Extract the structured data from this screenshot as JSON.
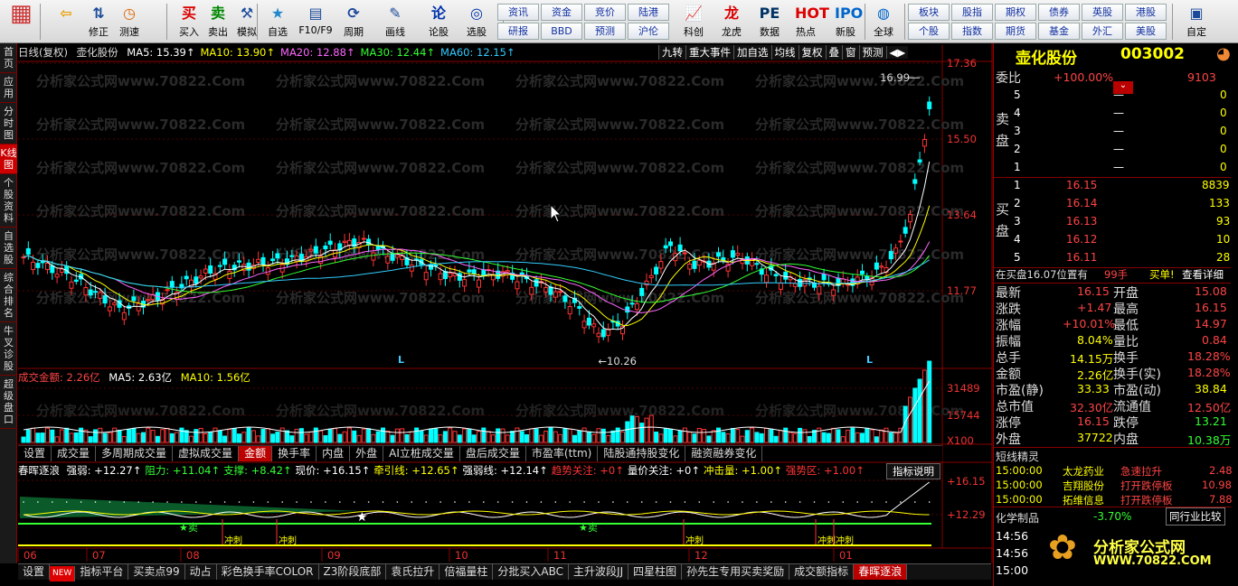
{
  "toolbar": {
    "buttons": [
      {
        "label": "",
        "icon": "app-logo-icon"
      },
      {
        "label": "",
        "icon": "back-arrow-icon"
      },
      {
        "label": "修正",
        "icon": "up-down-arrows-icon"
      },
      {
        "label": "测速",
        "icon": "clock-icon"
      },
      {
        "label": "买入",
        "icon": "buy-icon",
        "glyph": "买"
      },
      {
        "label": "卖出",
        "icon": "sell-icon",
        "glyph": "卖"
      },
      {
        "label": "模拟",
        "icon": "hammer-icon"
      },
      {
        "label": "自选",
        "icon": "star-icon"
      },
      {
        "label": "F10/F9",
        "icon": "f10-icon"
      },
      {
        "label": "周期",
        "icon": "period-icon"
      },
      {
        "label": "画线",
        "icon": "pencil-icon"
      },
      {
        "label": "论股",
        "icon": "forum-icon"
      },
      {
        "label": "选股",
        "icon": "stock-pick-icon"
      },
      {
        "label": "科创",
        "icon": "kechuang-icon"
      },
      {
        "label": "龙虎",
        "icon": "dragon-tiger-icon"
      },
      {
        "label": "数据",
        "icon": "pe-data-icon"
      },
      {
        "label": "热点",
        "icon": "hot-icon"
      },
      {
        "label": "新股",
        "icon": "ipo-icon"
      },
      {
        "label": "全球",
        "icon": "globe-icon"
      },
      {
        "label": "自定",
        "icon": "custom-icon"
      }
    ],
    "grid1": [
      "资讯",
      "资金",
      "竞价",
      "陆港",
      "研报",
      "BBD",
      "预测",
      "沪伦"
    ],
    "grid2": [
      "板块",
      "股指",
      "期权",
      "债券",
      "英股",
      "港股",
      "个股",
      "指数",
      "期货",
      "基金",
      "外汇",
      "美股"
    ]
  },
  "leftbar": [
    "首页",
    "应用",
    "分时图",
    "K线图",
    "个股资料",
    "自选股",
    "综合排名",
    "牛叉诊股",
    "超级盘口"
  ],
  "kline": {
    "title": "日线(复权)",
    "stock": "壶化股份",
    "ma": [
      {
        "label": "MA5: 15.39",
        "color": "#ffffff"
      },
      {
        "label": "MA10: 13.90",
        "color": "#ffff00"
      },
      {
        "label": "MA20: 12.88",
        "color": "#ff66ff"
      },
      {
        "label": "MA30: 12.44",
        "color": "#33ff33"
      },
      {
        "label": "MA60: 12.15",
        "color": "#33ccff"
      }
    ],
    "tools": [
      "九转",
      "重大事件",
      "加自选",
      "均线",
      "复权",
      "叠",
      "窗",
      "预测"
    ],
    "yaxis": [
      "17.36",
      "15.50",
      "13.64",
      "11.77"
    ],
    "high_label": "16.99",
    "low_label": "10.26",
    "months": [
      "06",
      "07",
      "08",
      "09",
      "10",
      "11",
      "12",
      "01"
    ],
    "watermark": "分析家公式网www.70822.Com"
  },
  "volume": {
    "title": "成交金额: 2.26亿",
    "ma5": "MA5: 2.63亿",
    "ma10": "MA10: 1.56亿",
    "yaxis": [
      "31489",
      "15744",
      "X100"
    ],
    "tabs": [
      "设置",
      "成交量",
      "多周期成交量",
      "虚拟成交量",
      "金额",
      "换手率",
      "内盘",
      "外盘",
      "AI立桩成交量",
      "盘后成交量",
      "市盈率(ttm)",
      "陆股通持股变化",
      "融资融券变化"
    ],
    "active": "金额"
  },
  "indicator": {
    "name": "春晖逐浪",
    "items": [
      {
        "label": "强弱: +12.27",
        "color": "#ffffff"
      },
      {
        "label": "阻力: +11.04",
        "color": "#33ff33"
      },
      {
        "label": "支撑: +8.42",
        "color": "#33ff33"
      },
      {
        "label": "现价: +16.15",
        "color": "#ffffff"
      },
      {
        "label": "牵引线: +12.65",
        "color": "#ffff00"
      },
      {
        "label": "强弱线: +12.14",
        "color": "#ffffff"
      },
      {
        "label": "趋势关注: +0",
        "color": "#ff3333"
      },
      {
        "label": "量价关注: +0",
        "color": "#ffffff"
      },
      {
        "label": "冲击量: +1.00",
        "color": "#ffff00"
      },
      {
        "label": "强势区: +1.00",
        "color": "#ff3333"
      }
    ],
    "help": "指标说明",
    "yaxis": [
      "+16.15",
      "+12.29"
    ],
    "sell_label": "卖",
    "chong": "冲刺"
  },
  "bottom_tabs": [
    "设置",
    "NEW",
    "指标平台",
    "买卖点99",
    "动占",
    "彩色换手率COLOR",
    "Z3阶段底部",
    "袁氏拉升",
    "倍福量柱",
    "分批买入ABC",
    "主升波段JJ",
    "四星柱图",
    "孙先生专用买卖奖励",
    "成交额指标",
    "春晖逐浪"
  ],
  "bottom_active": "春晖逐浪",
  "quote": {
    "name": "壶化股份",
    "code": "003002",
    "weibi_label": "委比",
    "weibi": "+100.00%",
    "weicha": "9103",
    "sell_label": "卖盘",
    "buy_label": "买盘",
    "asks": [
      {
        "n": "5",
        "p": "—",
        "v": "0"
      },
      {
        "n": "4",
        "p": "—",
        "v": "0"
      },
      {
        "n": "3",
        "p": "—",
        "v": "0"
      },
      {
        "n": "2",
        "p": "—",
        "v": "0"
      },
      {
        "n": "1",
        "p": "—",
        "v": "0"
      }
    ],
    "bids": [
      {
        "n": "1",
        "p": "16.15",
        "v": "8839"
      },
      {
        "n": "2",
        "p": "16.14",
        "v": "133"
      },
      {
        "n": "3",
        "p": "16.13",
        "v": "93"
      },
      {
        "n": "4",
        "p": "16.12",
        "v": "10"
      },
      {
        "n": "5",
        "p": "16.11",
        "v": "28"
      }
    ],
    "trade_note": "在买盘16.07位置有",
    "trade_qty": "99手",
    "trade_action": "买单!",
    "detail_link": "查看详细",
    "stats": [
      [
        "最新",
        "16.15",
        "开盘",
        "15.08"
      ],
      [
        "涨跌",
        "+1.47",
        "最高",
        "16.15"
      ],
      [
        "涨幅",
        "+10.01%",
        "最低",
        "14.97"
      ],
      [
        "振幅",
        "8.04%",
        "量比",
        "0.84"
      ],
      [
        "总手",
        "14.15万",
        "换手",
        "18.28%"
      ],
      [
        "金额",
        "2.26亿",
        "换手(实)",
        "18.28%"
      ],
      [
        "市盈(静)",
        "33.33",
        "市盈(动)",
        "38.84"
      ],
      [
        "总市值",
        "32.30亿",
        "流通值",
        "12.50亿"
      ],
      [
        "涨停",
        "16.15",
        "跌停",
        "13.21"
      ],
      [
        "外盘",
        "37722",
        "内盘",
        "10.38万"
      ]
    ],
    "spirit_title": "短线精灵",
    "spirit": [
      {
        "t": "15:00:00",
        "n": "太龙药业",
        "e": "急速拉升",
        "v": "2.48"
      },
      {
        "t": "15:00:00",
        "n": "吉翔股份",
        "e": "打开跌停板",
        "v": "10.98"
      },
      {
        "t": "15:00:00",
        "n": "拓维信息",
        "e": "打开跌停板",
        "v": "7.88"
      }
    ],
    "sector": "化学制品",
    "sector_chg": "-3.70%",
    "compare": "同行业比较",
    "ticks": [
      "14:56",
      "14:56",
      "15:00"
    ],
    "logo_text": "分析家公式网",
    "logo_url": "WWW.70822.COM"
  }
}
